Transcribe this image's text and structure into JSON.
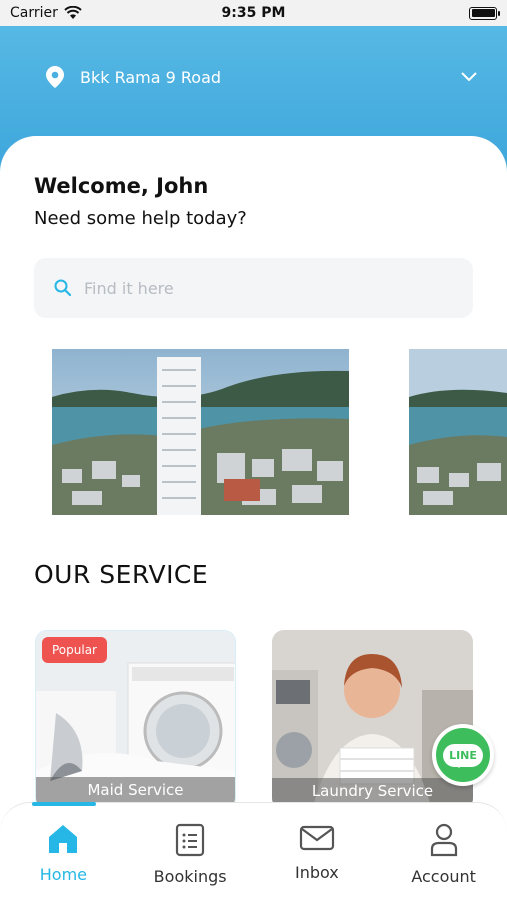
{
  "status_bar": {
    "carrier": "Carrier",
    "time": "9:35 PM"
  },
  "header": {
    "location": "Bkk Rama 9 Road"
  },
  "welcome": {
    "title": "Welcome, John",
    "subtitle": "Need some help today?"
  },
  "search": {
    "placeholder": "Find it here"
  },
  "services": {
    "title": "OUR SERVICE",
    "items": [
      {
        "label": "Maid Service",
        "badge": "Popular"
      },
      {
        "label": "Laundry Service"
      }
    ]
  },
  "line_button": {
    "label": "LINE"
  },
  "tabbar": {
    "items": [
      {
        "label": "Home",
        "active": true
      },
      {
        "label": "Bookings"
      },
      {
        "label": "Inbox"
      },
      {
        "label": "Account"
      }
    ]
  },
  "colors": {
    "accent": "#26b7e6",
    "header": "#4fb3e3",
    "badge": "#ef5350",
    "line": "#3ebd5c"
  }
}
